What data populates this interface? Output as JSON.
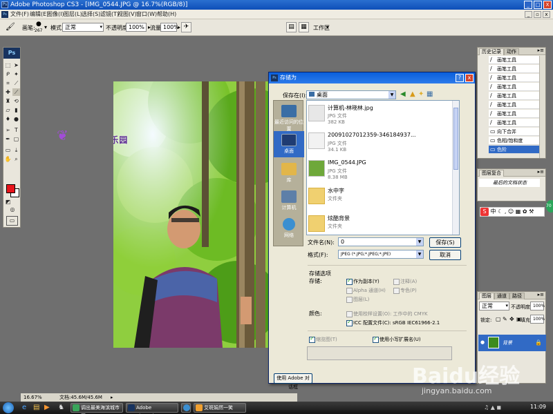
{
  "window": {
    "title": "Adobe Photoshop CS3 - [IMG_0544.JPG @ 16.7%(RGB/8)]",
    "min": "_",
    "max": "□",
    "close": "X"
  },
  "menu": [
    "文件(F)",
    "编辑(E)",
    "图像(I)",
    "图层(L)",
    "选择(S)",
    "滤镜(T)",
    "视图(V)",
    "窗口(W)",
    "帮助(H)"
  ],
  "options": {
    "brush_label": "画笔:",
    "brush_size": "267",
    "mode_label": "模式:",
    "mode_value": "正常",
    "opacity_label": "不透明度:",
    "opacity_value": "100%",
    "flow_label": "流量:",
    "flow_value": "100%",
    "workspace": "工作区"
  },
  "document": {
    "watermark": "百度ID: 林墨乐园"
  },
  "dialog": {
    "title": "存储为",
    "save_in_label": "保存在(I):",
    "save_in_value": "桌面",
    "places": [
      "最近访问的位置",
      "桌面",
      "库",
      "计算机",
      "网络"
    ],
    "files": [
      {
        "name": "计算机-林晓林.jpg",
        "type": "JPG 文件",
        "size": "382 KB"
      },
      {
        "name": "20091027012359-346184937...",
        "type": "JPG 文件",
        "size": "34.1 KB"
      },
      {
        "name": "IMG_0544.JPG",
        "type": "JPG 文件",
        "size": "8.38 MB"
      },
      {
        "name": "水中字",
        "type": "文件夹",
        "size": ""
      },
      {
        "name": "炫酷背景",
        "type": "文件夹",
        "size": ""
      }
    ],
    "filename_label": "文件名(N):",
    "filename_value": "0",
    "format_label": "格式(F):",
    "format_value": "JPEG (*.JPG;*.JPEG;*.JPE)",
    "save_button": "保存(S)",
    "cancel_button": "取消",
    "save_options_label": "存储选项",
    "store_label": "存储:",
    "as_copy": "作为副本(Y)",
    "annotations": "注释(A)",
    "alpha": "Alpha 通道(H)",
    "spot": "专色(P)",
    "layers": "图层(L)",
    "color_label": "颜色:",
    "proof": "使用校样设置(O): 工作中的 CMYK",
    "icc": "ICC 配置文件(C): sRGB IEC61966-2.1",
    "thumbnail": "缩览图(T)",
    "lowercase": "使用小写扩展名(U)",
    "adobe_dialog": "使用 Adobe 对话框"
  },
  "history": {
    "tabs": [
      "历史记录",
      "动作"
    ],
    "items": [
      "画笔工具",
      "画笔工具",
      "画笔工具",
      "画笔工具",
      "画笔工具",
      "画笔工具",
      "画笔工具",
      "画笔工具",
      "向下合并",
      "色相/饱和度",
      "色阶"
    ],
    "selected_index": 10
  },
  "layer_comps": {
    "tab": "图层复合",
    "item": "最后的文档状态"
  },
  "layers_panel": {
    "tabs": [
      "图层",
      "通道",
      "路径"
    ],
    "mode": "正常",
    "opacity_label": "不透明度:",
    "opacity_value": "100%",
    "lock_label": "锁定:",
    "fill_label": "填充:",
    "fill_value": "100%",
    "layer_name": "背景",
    "eye": "●",
    "lock": "🔒"
  },
  "status": {
    "zoom": "16.67%",
    "doc": "文档:45.6M/45.6M"
  },
  "taskbar": {
    "items": [
      "调出最美海滨城市图...",
      "Adobe Photoshop ...",
      "艾斑娟然一笑"
    ],
    "clock": "11:09"
  },
  "watermark_logo": "Baidu经验",
  "watermark_url": "jingyan.baidu.com",
  "colors": {
    "foreground": "#e8141b",
    "background": "#ffffff",
    "selection": "#316ac5"
  }
}
